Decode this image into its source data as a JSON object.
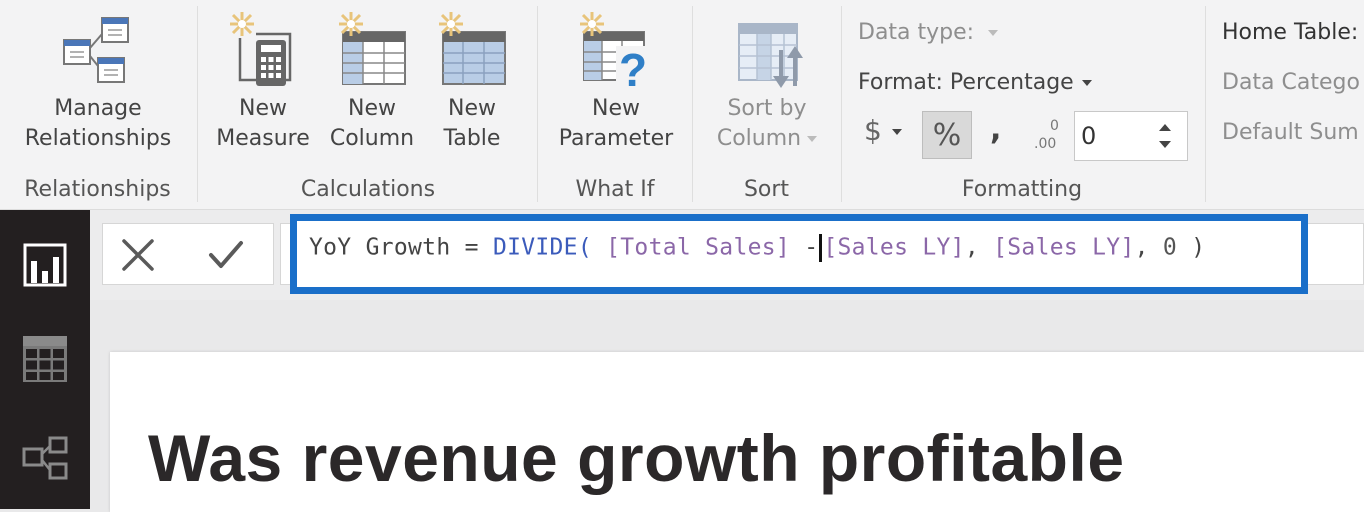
{
  "ribbon": {
    "groups": {
      "relationships": {
        "label": "Relationships",
        "buttons": [
          {
            "line1": "Manage",
            "line2": "Relationships",
            "icon": "manage-relationships-icon"
          }
        ]
      },
      "calculations": {
        "label": "Calculations",
        "buttons": [
          {
            "line1": "New",
            "line2": "Measure",
            "icon": "new-measure-icon"
          },
          {
            "line1": "New",
            "line2": "Column",
            "icon": "new-column-icon"
          },
          {
            "line1": "New",
            "line2": "Table",
            "icon": "new-table-icon"
          }
        ]
      },
      "whatif": {
        "label": "What If",
        "buttons": [
          {
            "line1": "New",
            "line2": "Parameter",
            "icon": "new-parameter-icon"
          }
        ]
      },
      "sort": {
        "label": "Sort",
        "buttons": [
          {
            "line1": "Sort by",
            "line2": "Column",
            "icon": "sort-by-column-icon",
            "disabled": true
          }
        ]
      },
      "formatting": {
        "label": "Formatting",
        "data_type_label": "Data type:",
        "format_label": "Format: Percentage",
        "currency_symbol": "$",
        "percent_symbol": "%",
        "comma_symbol": ",",
        "decimal_icon_text": ".00",
        "decimal_places_value": "0"
      },
      "properties": {
        "home_table_label": "Home Table:",
        "data_category_label": "Data Catego",
        "default_summarization_label": "Default Sum"
      }
    }
  },
  "left_nav": {
    "items": [
      {
        "name": "report-view",
        "icon": "report-icon",
        "active": true
      },
      {
        "name": "data-view",
        "icon": "table-grid-icon",
        "active": false
      },
      {
        "name": "model-view",
        "icon": "relationships-icon",
        "active": false
      }
    ]
  },
  "formula_bar": {
    "cancel_icon": "✕",
    "commit_icon": "✓",
    "tokens": {
      "measure_name": "YoY Growth",
      "equals": " = ",
      "function": "DIVIDE(",
      "space1": " ",
      "ref1": "[Total Sales]",
      "minus": " -",
      "ref2": "[Sales LY]",
      "comma1": ", ",
      "ref3": "[Sales LY]",
      "comma2": ", ",
      "num": "0",
      "close": " )"
    },
    "highlight_color": "#1a6fc9"
  },
  "report": {
    "title": "Was revenue growth profitable"
  }
}
